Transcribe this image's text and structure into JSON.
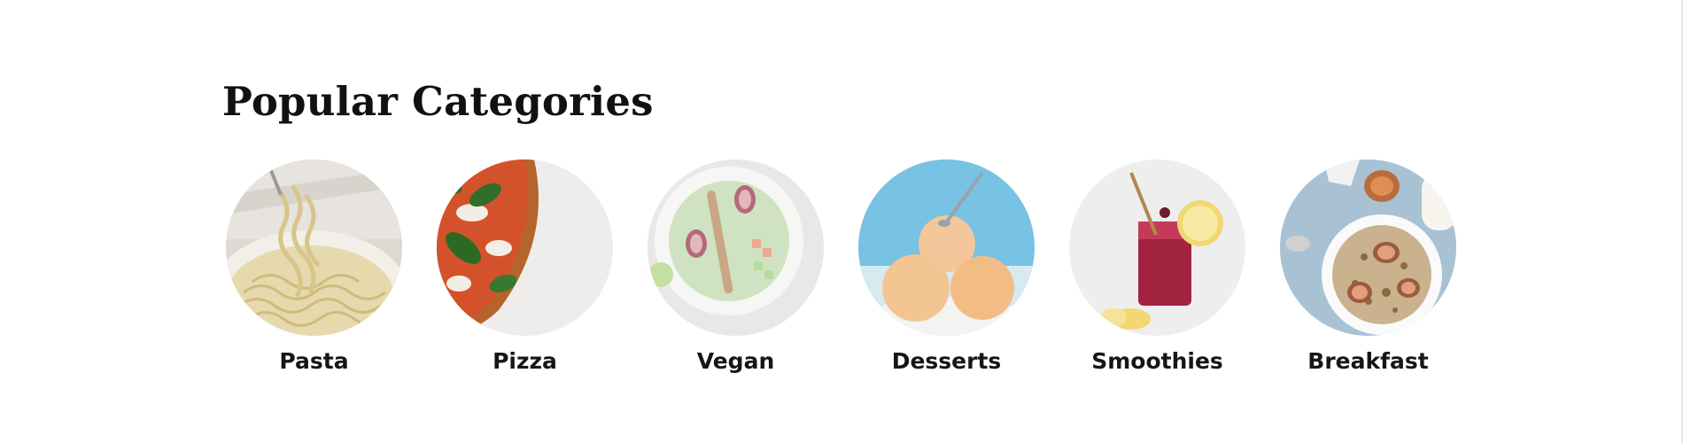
{
  "section": {
    "title": "Popular Categories"
  },
  "categories": [
    {
      "label": "Pasta",
      "icon": "pasta-image"
    },
    {
      "label": "Pizza",
      "icon": "pizza-image"
    },
    {
      "label": "Vegan",
      "icon": "vegan-bowl-image"
    },
    {
      "label": "Desserts",
      "icon": "ice-cream-image"
    },
    {
      "label": "Smoothies",
      "icon": "smoothie-jar-image"
    },
    {
      "label": "Breakfast",
      "icon": "granola-bowl-image"
    }
  ]
}
